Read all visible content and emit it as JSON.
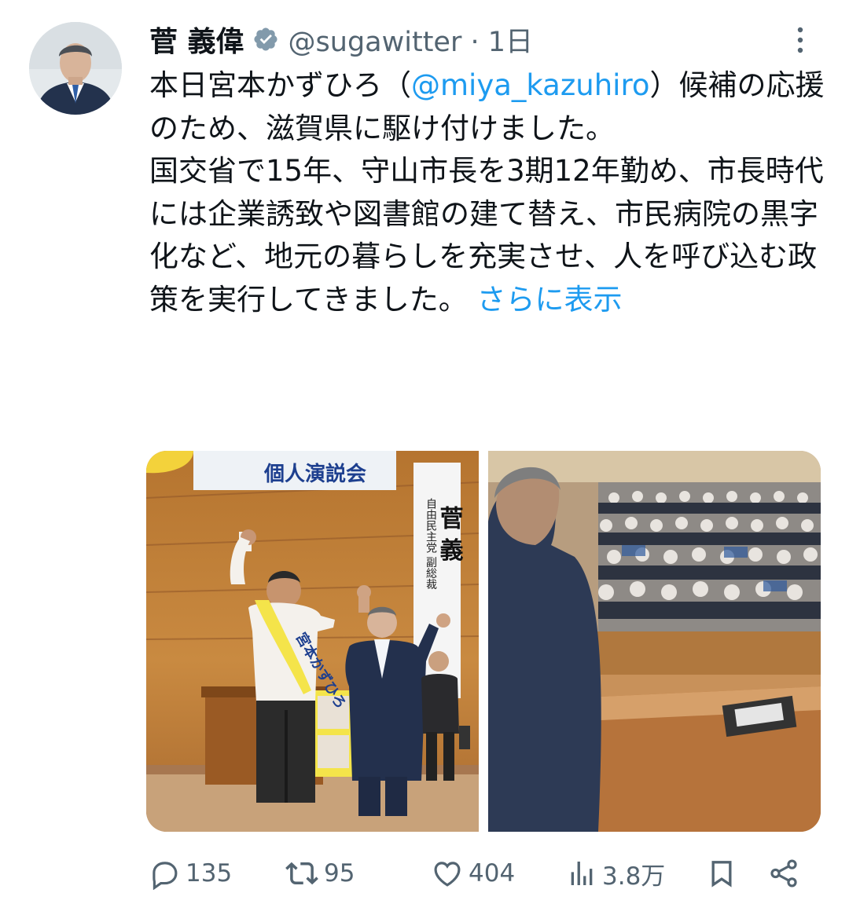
{
  "author": {
    "name": "菅 義偉",
    "handle": "@sugawitter",
    "time": "1日",
    "handle_time": "@sugawitter · 1日"
  },
  "tweet": {
    "text_before_mention": "本日宮本かずひろ（",
    "mention": "@miya_kazuhiro",
    "text_after_mention": "）候補の応援のため、滋賀県に駆け付けました。\n国交省で15年、守山市長を3期12年勤め、市長時代には企業誘致や図書館の建て替え、市民病院の黒字化など、地元の暮らしを充実させ、人を呼び込む政策を実行してきました。 ",
    "show_more": "さらに表示"
  },
  "media": {
    "left_banner": "個人演説会",
    "left_sign": "自由民主党 副総裁",
    "left_sign_name": "菅 義",
    "sash_text": "宮本かずひろ",
    "poster_text": "宮本"
  },
  "actions": {
    "replies": "135",
    "retweets": "95",
    "likes": "404",
    "views": "3.8万"
  },
  "colors": {
    "accent": "#1d9bf0",
    "muted": "#536471",
    "text": "#0f1419",
    "verified": "#829aab"
  },
  "icons": [
    "verified-icon",
    "more-icon",
    "reply-icon",
    "retweet-icon",
    "like-icon",
    "views-icon",
    "bookmark-icon",
    "share-icon"
  ]
}
